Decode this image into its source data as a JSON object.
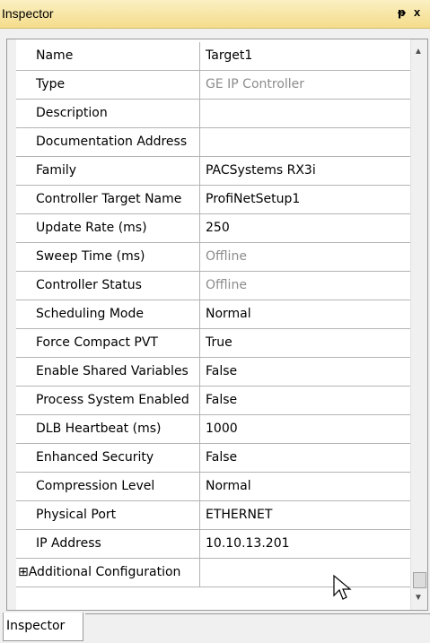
{
  "titlebar": {
    "title": "Inspector",
    "pin_glyph": "ᵽ",
    "close_glyph": "x"
  },
  "properties": [
    {
      "name": "Name",
      "value": "Target1",
      "readonly": false
    },
    {
      "name": "Type",
      "value": "GE IP Controller",
      "readonly": true
    },
    {
      "name": "Description",
      "value": "",
      "readonly": false
    },
    {
      "name": "Documentation Address",
      "value": "",
      "readonly": false
    },
    {
      "name": "Family",
      "value": "PACSystems RX3i",
      "readonly": false
    },
    {
      "name": "Controller Target Name",
      "value": "ProfiNetSetup1",
      "readonly": false
    },
    {
      "name": "Update Rate (ms)",
      "value": "250",
      "readonly": false
    },
    {
      "name": "Sweep Time (ms)",
      "value": "Offline",
      "readonly": true
    },
    {
      "name": "Controller Status",
      "value": "Offline",
      "readonly": true
    },
    {
      "name": "Scheduling Mode",
      "value": "Normal",
      "readonly": false
    },
    {
      "name": "Force Compact PVT",
      "value": "True",
      "readonly": false
    },
    {
      "name": "Enable Shared Variables",
      "value": "False",
      "readonly": false
    },
    {
      "name": "Process System Enabled",
      "value": "False",
      "readonly": false
    },
    {
      "name": "DLB Heartbeat (ms)",
      "value": "1000",
      "readonly": false
    },
    {
      "name": "Enhanced Security",
      "value": "False",
      "readonly": false
    },
    {
      "name": "Compression Level",
      "value": "Normal",
      "readonly": false
    },
    {
      "name": "Physical Port",
      "value": "ETHERNET",
      "readonly": false
    },
    {
      "name": "IP Address",
      "value": "10.10.13.201",
      "readonly": false
    },
    {
      "name": "⊞Additional Configuration",
      "value": "",
      "readonly": false,
      "expandable": true
    }
  ],
  "scrollbar": {
    "up_glyph": "▲",
    "down_glyph": "▼",
    "position": 0.95
  },
  "tabs": [
    {
      "label": "Inspector",
      "active": true
    }
  ]
}
